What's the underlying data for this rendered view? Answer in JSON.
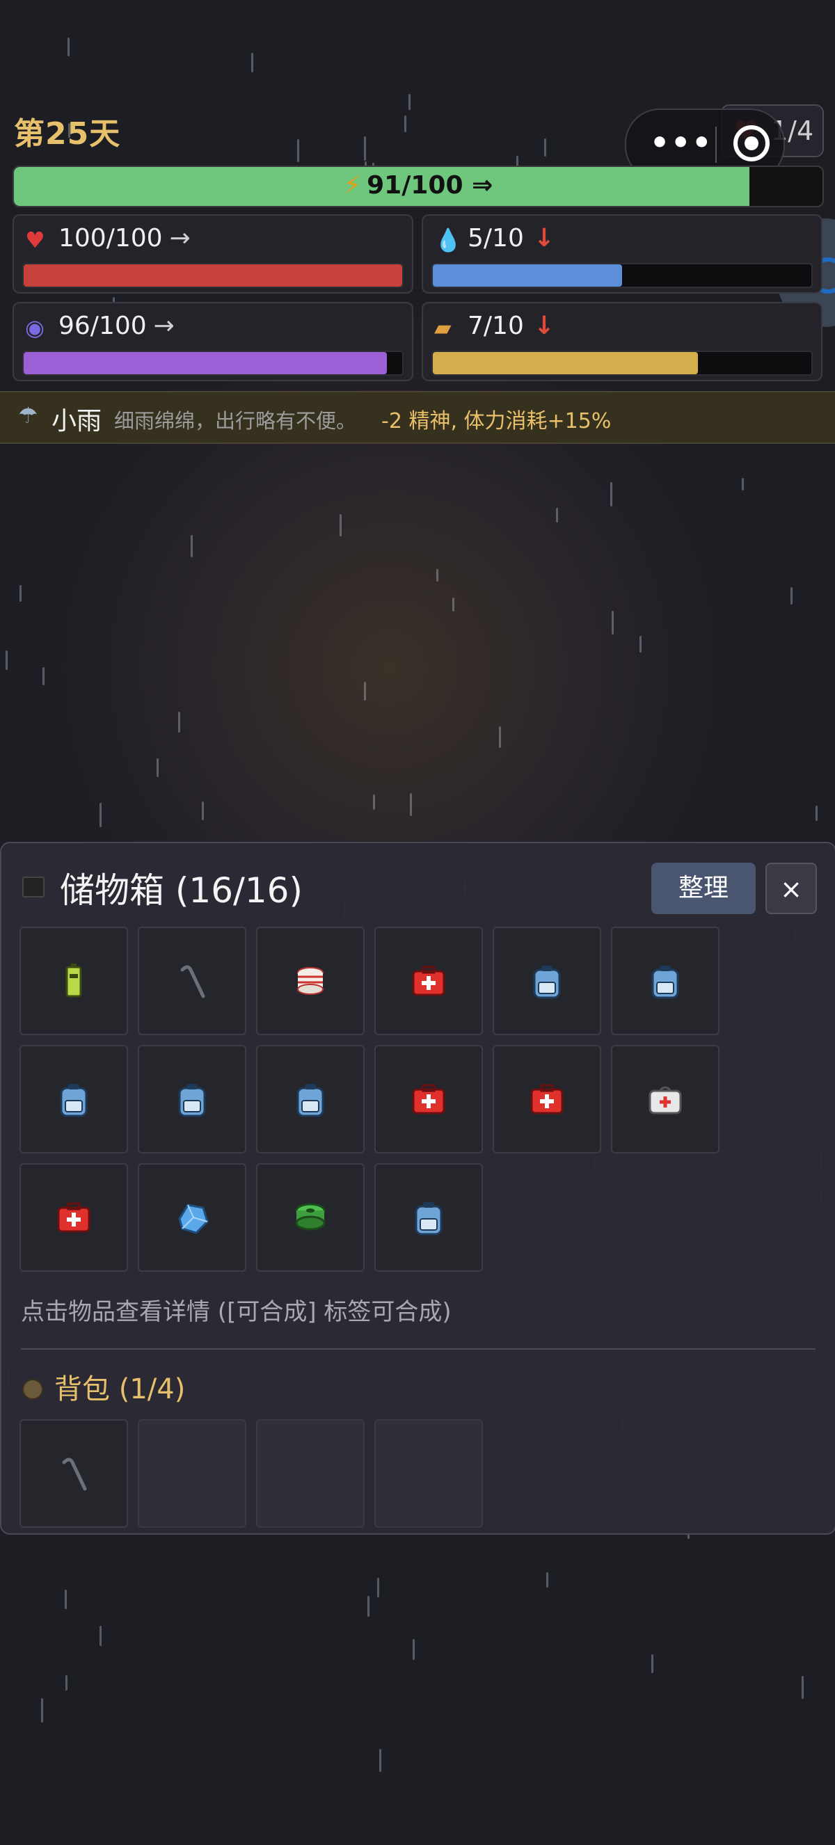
{
  "header": {
    "day": "第25天",
    "pack_count": "1/4"
  },
  "energy": {
    "label": "91/100 ⇒",
    "value": 91,
    "max": 100,
    "color": "#6ec77d"
  },
  "stats": [
    {
      "name": "health",
      "icon": "heart-icon",
      "text": "100/100",
      "trend": "→",
      "value": 100,
      "max": 100,
      "color": "#c9413c"
    },
    {
      "name": "water",
      "icon": "droplet-icon",
      "text": "5/10",
      "trend": "↓",
      "value": 5,
      "max": 10,
      "color": "#5b8edb"
    },
    {
      "name": "spirit",
      "icon": "orb-icon",
      "text": "96/100",
      "trend": "→",
      "value": 96,
      "max": 100,
      "color": "#9b5fd6"
    },
    {
      "name": "food",
      "icon": "bread-icon",
      "text": "7/10",
      "trend": "↓",
      "value": 7,
      "max": 10,
      "color": "#d4ad4c"
    }
  ],
  "weather": {
    "icon": "rain-cloud-icon",
    "name": "小雨",
    "description": "细雨绵绵，出行略有不便。",
    "effect": "-2 精神, 体力消耗+15%"
  },
  "storage": {
    "title": "储物箱 (16/16)",
    "sort_label": "整理",
    "close_label": "×",
    "items": [
      "battery-icon",
      "crowbar-icon",
      "bandage-roll-icon",
      "first-aid-kit-icon",
      "backpack-icon",
      "backpack-icon",
      "backpack-icon",
      "backpack-icon",
      "backpack-icon",
      "first-aid-kit-icon",
      "first-aid-kit-icon",
      "medical-bag-icon",
      "first-aid-kit-icon",
      "blue-crystal-icon",
      "green-spool-icon",
      "backpack-icon"
    ],
    "hint": "点击物品查看详情 ([可合成] 标签可合成)"
  },
  "backpack": {
    "title": "背包 (1/4)",
    "items": [
      "crowbar-icon",
      null,
      null,
      null
    ]
  }
}
